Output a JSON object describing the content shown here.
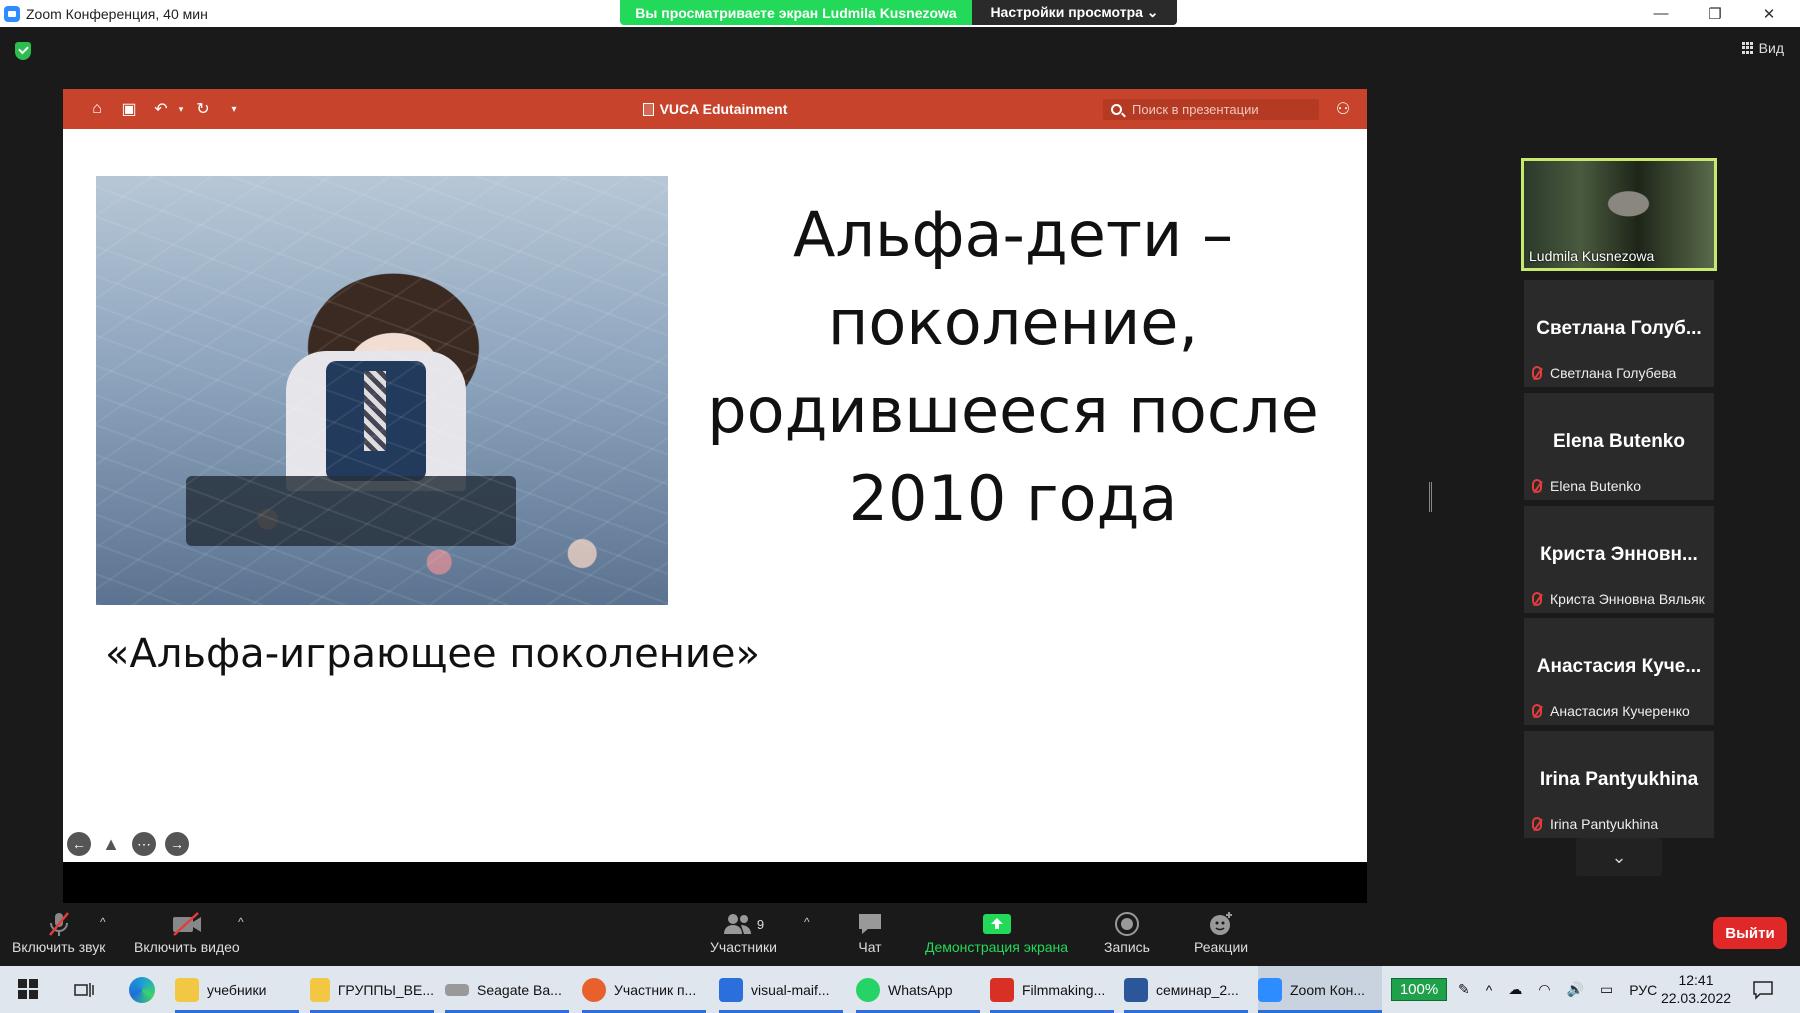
{
  "window": {
    "title": "Zoom Конференция, 40 мин",
    "viewing_banner": "Вы просматриваете экран Ludmila Kusnezowa",
    "view_options": "Настройки просмотра ⌄",
    "view_button": "Вид"
  },
  "presentation": {
    "app_title": "VUCA Edutainment",
    "search_placeholder": "Поиск в презентации",
    "slide": {
      "title_lines": [
        "Альфа-дети –",
        "поколение,",
        "родившееся после",
        "2010 года"
      ],
      "subtitle": "«Альфа-играющее поколение»"
    }
  },
  "participants": [
    {
      "tile_name": "",
      "label": "Ludmila Kusnezowa",
      "video": true
    },
    {
      "tile_name": "Светлана Голуб...",
      "label": "Светлана Голубева",
      "muted": true
    },
    {
      "tile_name": "Elena Butenko",
      "label": "Elena Butenko",
      "muted": true
    },
    {
      "tile_name": "Криста Энновн...",
      "label": "Криста Энновна Вяльяк",
      "muted": true
    },
    {
      "tile_name": "Анастасия Куче...",
      "label": "Анастасия Кучеренко",
      "muted": true
    },
    {
      "tile_name": "Irina Pantyukhina",
      "label": "Irina Pantyukhina",
      "muted": true
    }
  ],
  "toolbar": {
    "unmute": "Включить звук",
    "start_video": "Включить видео",
    "participants": "Участники",
    "participants_count": "9",
    "chat": "Чат",
    "share": "Демонстрация экрана",
    "record": "Запись",
    "reactions": "Реакции",
    "leave": "Выйти"
  },
  "taskbar": {
    "apps": [
      {
        "label": "учебники",
        "icon": "folder-icon",
        "color": "#f2c744"
      },
      {
        "label": "ГРУППЫ_ВЕ...",
        "icon": "folder-icon",
        "color": "#f2c744"
      },
      {
        "label": "Seagate Ba...",
        "icon": "drive-icon",
        "color": "#999999"
      },
      {
        "label": "Участник п...",
        "icon": "firefox-icon",
        "color": "#e8602c"
      },
      {
        "label": "visual-maif...",
        "icon": "photos-icon",
        "color": "#2a6fdb"
      },
      {
        "label": "WhatsApp",
        "icon": "whatsapp-icon",
        "color": "#25d366"
      },
      {
        "label": "Filmmaking...",
        "icon": "pdf-icon",
        "color": "#d93025"
      },
      {
        "label": "семинар_2...",
        "icon": "word-icon",
        "color": "#2b579a"
      },
      {
        "label": "Zoom Кон...",
        "icon": "zoom-icon",
        "color": "#2d8cff"
      }
    ],
    "battery": "100%",
    "language": "РУС",
    "time": "12:41",
    "date": "22.03.2022"
  },
  "colors": {
    "ppt_bar": "#c8432b",
    "banner_green": "#23d959",
    "active_speaker": "#c7e96f",
    "leave": "#e02828"
  }
}
